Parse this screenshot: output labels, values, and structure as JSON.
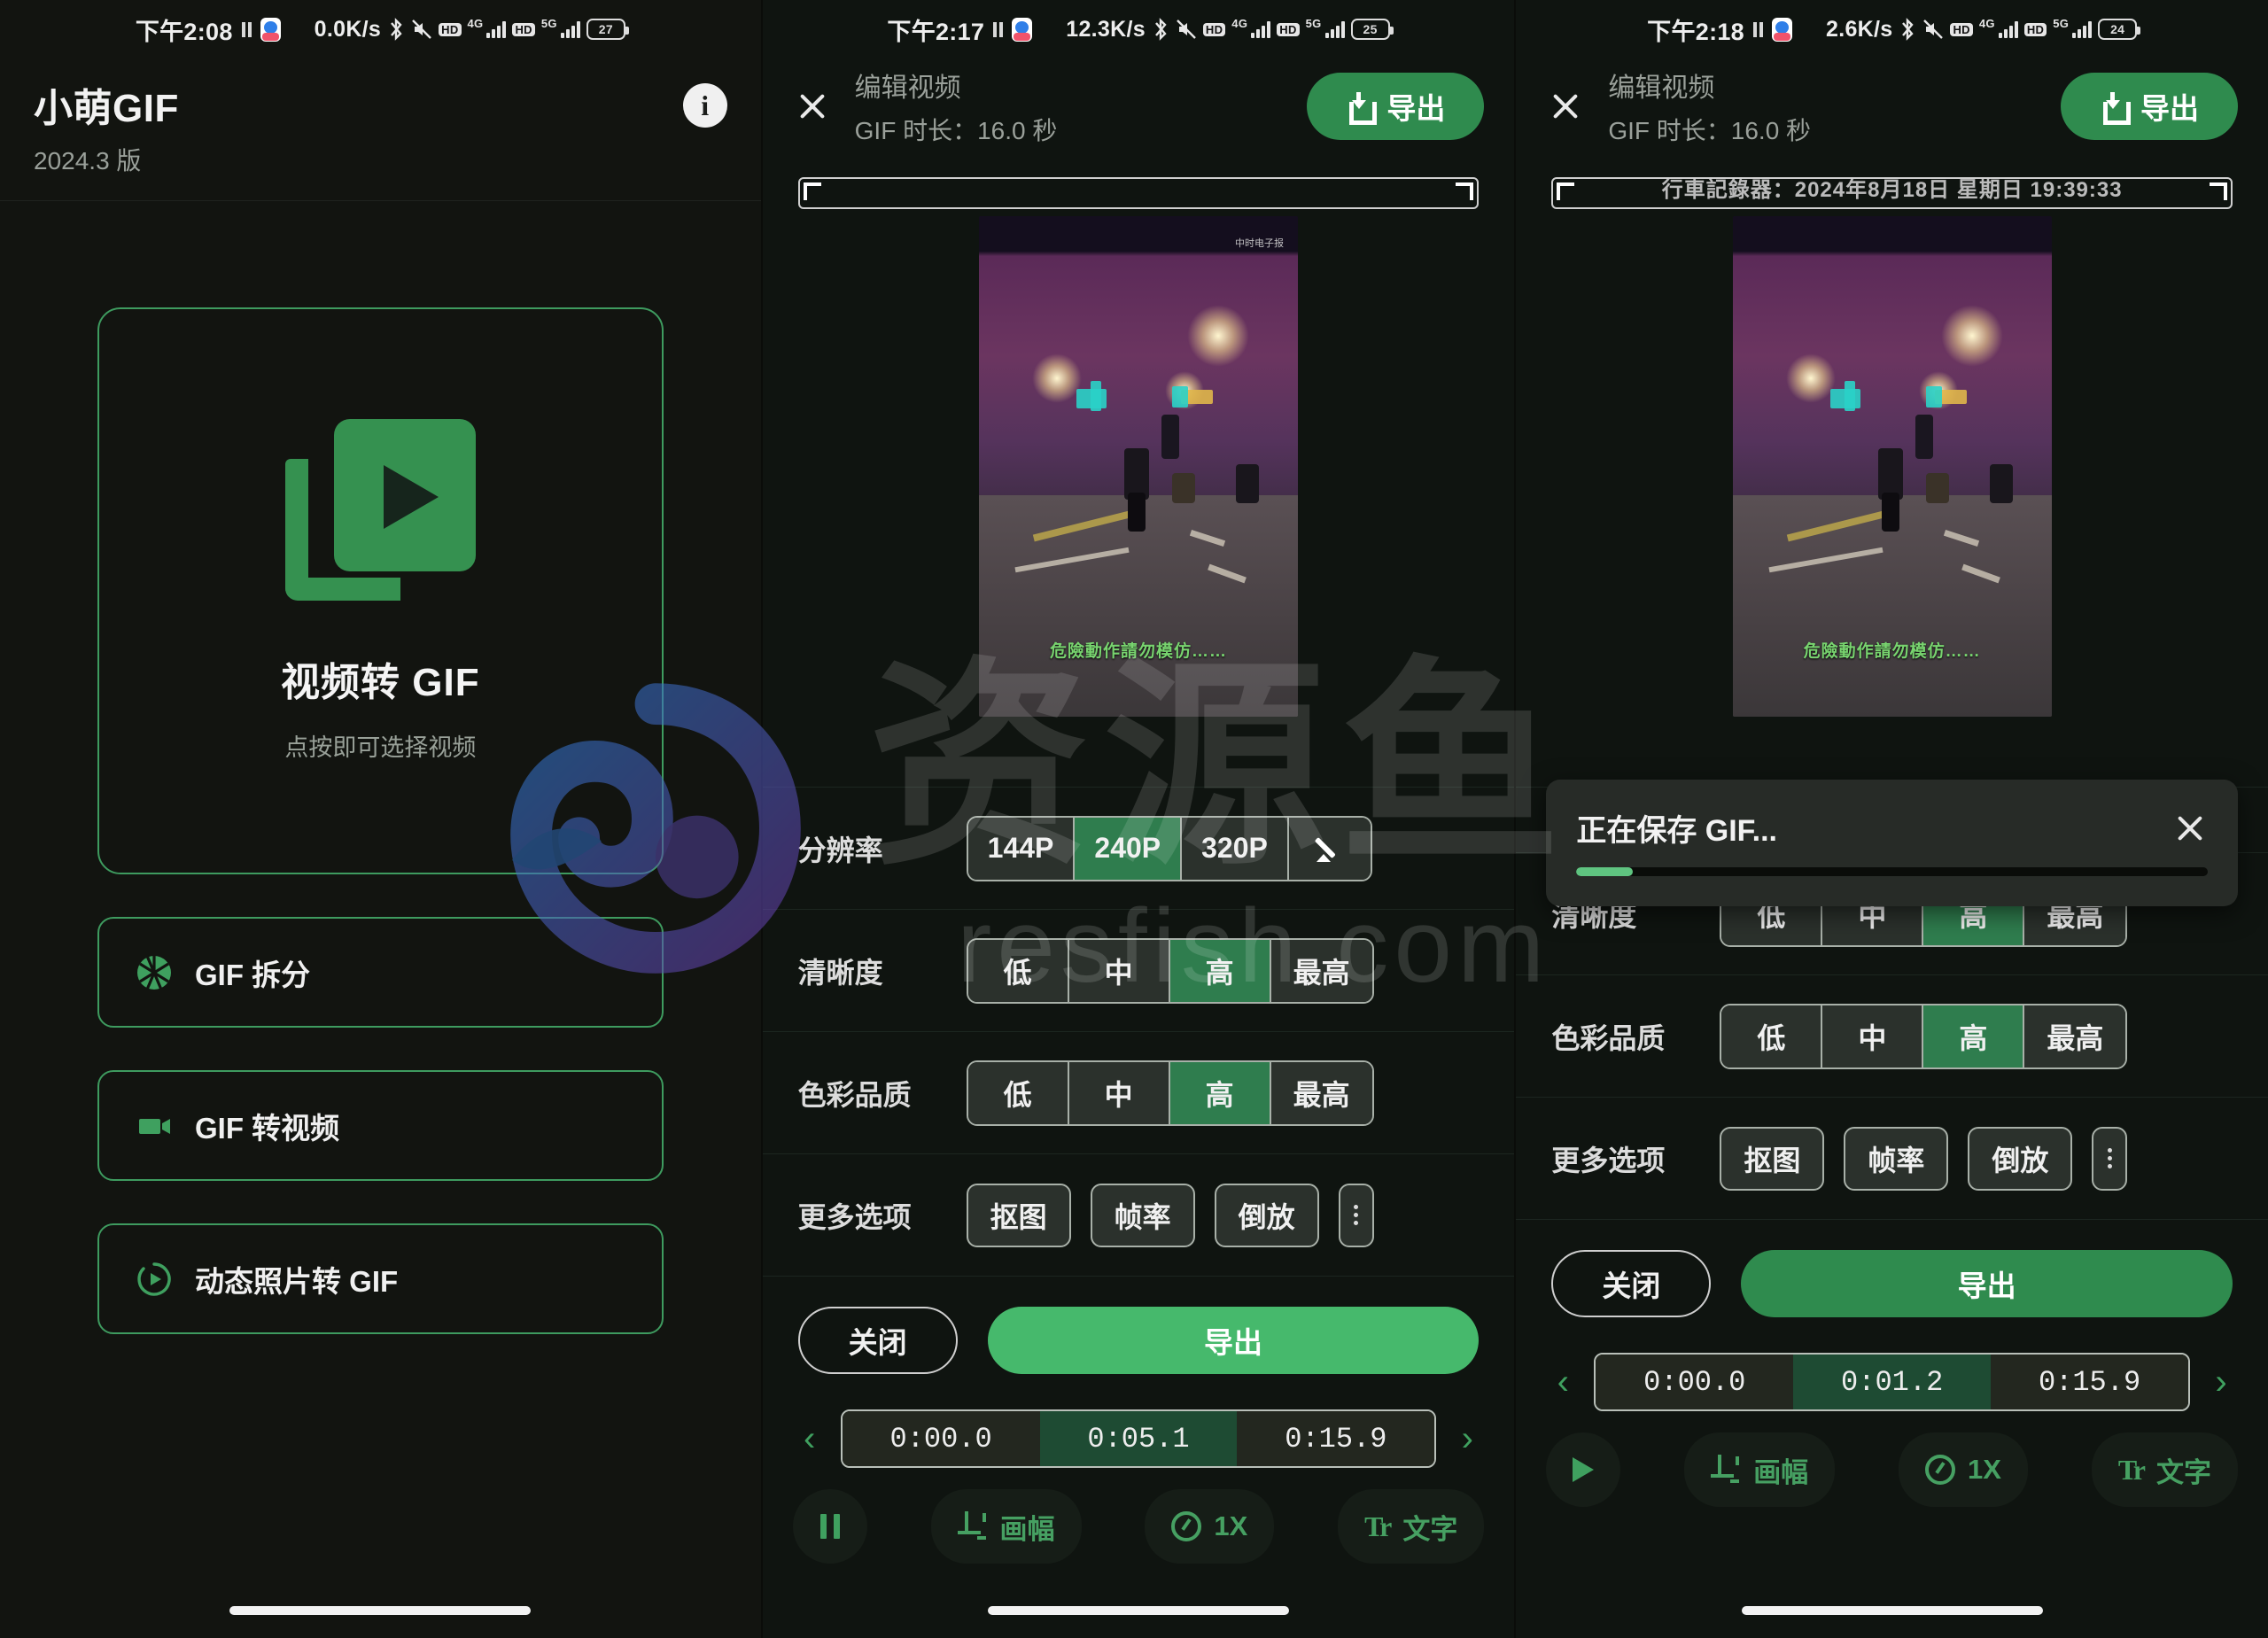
{
  "watermark": {
    "brand": "资源鱼",
    "url": "resfish.com"
  },
  "panel1": {
    "status": {
      "time": "下午2:08",
      "speed": "0.0K/s",
      "battery": "27"
    },
    "app_title": "小萌GIF",
    "app_version": "2024.3 版",
    "info_label": "i",
    "card": {
      "title": "视频转 GIF",
      "subtitle": "点按即可选择视频"
    },
    "options": [
      {
        "label": "GIF 拆分",
        "icon": "aperture-icon"
      },
      {
        "label": "GIF 转视频",
        "icon": "video-camera-icon"
      },
      {
        "label": "动态照片转 GIF",
        "icon": "live-photo-icon"
      }
    ]
  },
  "panel2": {
    "status": {
      "time": "下午2:17",
      "speed": "12.3K/s",
      "battery": "25"
    },
    "header": {
      "title": "编辑视频",
      "duration": "GIF 时长：16.0 秒",
      "export": "导出"
    },
    "video": {
      "caption": "危險動作請勿模仿……",
      "logo": "中时电子报"
    },
    "settings": [
      {
        "label": "分辨率",
        "type": "segmented",
        "options": [
          "144P",
          "240P",
          "320P"
        ],
        "selected": "240P",
        "has_edit": true
      },
      {
        "label": "清晰度",
        "type": "segmented",
        "options": [
          "低",
          "中",
          "高",
          "最高"
        ],
        "selected": "高"
      },
      {
        "label": "色彩品质",
        "type": "segmented",
        "options": [
          "低",
          "中",
          "高",
          "最高"
        ],
        "selected": "高"
      },
      {
        "label": "更多选项",
        "type": "chips",
        "options": [
          "抠图",
          "帧率",
          "倒放"
        ]
      }
    ],
    "actions": {
      "close": "关闭",
      "export": "导出"
    },
    "timeline": {
      "start": "0:00.0",
      "current": "0:05.1",
      "end": "0:15.9"
    },
    "toolbar": {
      "playback": "pause-icon",
      "crop": "画幅",
      "speed": "1X",
      "text": "文字"
    }
  },
  "panel3": {
    "status": {
      "time": "下午2:18",
      "speed": "2.6K/s",
      "battery": "24"
    },
    "header": {
      "title": "编辑视频",
      "duration": "GIF 时长：16.0 秒",
      "export": "导出"
    },
    "video": {
      "caption": "危險動作請勿模仿……",
      "datebar": "行車記錄器：2024年8月18日 星期日 19:39:33"
    },
    "saving": {
      "text": "正在保存 GIF...",
      "progress": 9
    },
    "settings": [
      {
        "label": "清晰度",
        "type": "segmented",
        "options": [
          "低",
          "中",
          "高",
          "最高"
        ],
        "selected": "高"
      },
      {
        "label": "色彩品质",
        "type": "segmented",
        "options": [
          "低",
          "中",
          "高",
          "最高"
        ],
        "selected": "高"
      },
      {
        "label": "更多选项",
        "type": "chips",
        "options": [
          "抠图",
          "帧率",
          "倒放"
        ]
      }
    ],
    "actions": {
      "close": "关闭",
      "export": "导出"
    },
    "timeline": {
      "start": "0:00.0",
      "current": "0:01.2",
      "end": "0:15.9"
    },
    "toolbar": {
      "playback": "play-icon",
      "crop": "画幅",
      "speed": "1X",
      "text": "文字"
    }
  }
}
